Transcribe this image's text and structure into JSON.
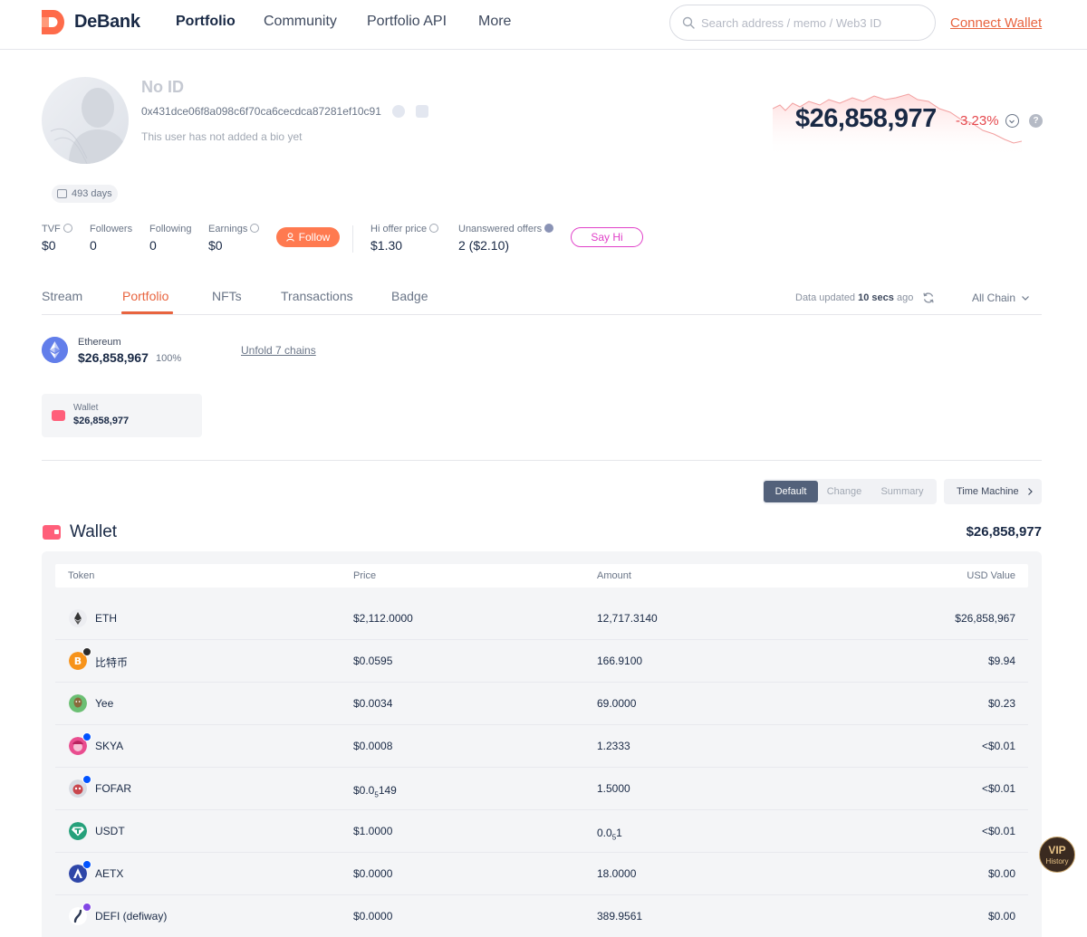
{
  "header": {
    "brand": "DeBank",
    "nav": [
      {
        "label": "Portfolio",
        "active": true
      },
      {
        "label": "Community",
        "active": false
      },
      {
        "label": "Portfolio API",
        "active": false
      },
      {
        "label": "More",
        "active": false
      }
    ],
    "search_placeholder": "Search address / memo / Web3 ID",
    "connect_label": "Connect Wallet"
  },
  "profile": {
    "name": "No ID",
    "address": "0x431dce06f8a098c6f70ca6cecdca87281ef10c91",
    "bio": "This user has not added a bio yet",
    "days": "493 days"
  },
  "net_worth": {
    "value": "$26,858,977",
    "change": "-3.23%"
  },
  "stats": [
    {
      "label": "TVF",
      "value": "$0",
      "help": true
    },
    {
      "label": "Followers",
      "value": "0",
      "help": false
    },
    {
      "label": "Following",
      "value": "0",
      "help": false
    },
    {
      "label": "Earnings",
      "value": "$0",
      "help": true
    }
  ],
  "follow_label": "Follow",
  "offers": [
    {
      "label": "Hi offer price",
      "value": "$1.30"
    },
    {
      "label": "Unanswered offers",
      "value": "2 ($2.10)"
    }
  ],
  "sayhi_label": "Say Hi",
  "tabs": [
    {
      "label": "Stream"
    },
    {
      "label": "Portfolio",
      "active": true
    },
    {
      "label": "NFTs"
    },
    {
      "label": "Transactions"
    },
    {
      "label": "Badge"
    }
  ],
  "data_updated": {
    "prefix": "Data updated",
    "time": "10 secs",
    "suffix": "ago"
  },
  "chain_filter": "All Chain",
  "chain_summary": {
    "name": "Ethereum",
    "value": "$26,858,967",
    "percent": "100%",
    "unfold": "Unfold 7 chains"
  },
  "wallet_card": {
    "label": "Wallet",
    "value": "$26,858,977"
  },
  "view_modes": [
    "Default",
    "Change",
    "Summary"
  ],
  "time_machine": "Time Machine",
  "wallet": {
    "title": "Wallet",
    "total": "$26,858,977",
    "columns": [
      "Token",
      "Price",
      "Amount",
      "USD Value"
    ],
    "rows": [
      {
        "token": "ETH",
        "price": "$2,112.0000",
        "amount": "12,717.3140",
        "usd": "$26,858,967",
        "icon_color": "#ecedf1"
      },
      {
        "token": "比特币",
        "price": "$0.0595",
        "amount": "166.9100",
        "usd": "$9.94",
        "icon_color": "#f7931a"
      },
      {
        "token": "Yee",
        "price": "$0.0034",
        "amount": "69.0000",
        "usd": "$0.23",
        "icon_color": "#6bbf73"
      },
      {
        "token": "SKYA",
        "price": "$0.0008",
        "amount": "1.2333",
        "usd": "<$0.01",
        "icon_color": "#e94d8f"
      },
      {
        "token": "FOFAR",
        "price_parts": [
          "$0.0",
          "5",
          "149"
        ],
        "amount": "1.5000",
        "usd": "<$0.01",
        "icon_color": "#d8dbe2"
      },
      {
        "token": "USDT",
        "price": "$1.0000",
        "amount_parts": [
          "0.0",
          "5",
          "1"
        ],
        "usd": "<$0.01",
        "icon_color": "#26a17b"
      },
      {
        "token": "AETX",
        "price": "$0.0000",
        "amount": "18.0000",
        "usd": "$0.00",
        "icon_color": "#2e46a8"
      },
      {
        "token": "DEFI (defiway)",
        "price": "$0.0000",
        "amount": "389.9561",
        "usd": "$0.00",
        "icon_color": "#ffffff"
      }
    ]
  },
  "vip": {
    "line1": "VIP",
    "line2": "History"
  }
}
